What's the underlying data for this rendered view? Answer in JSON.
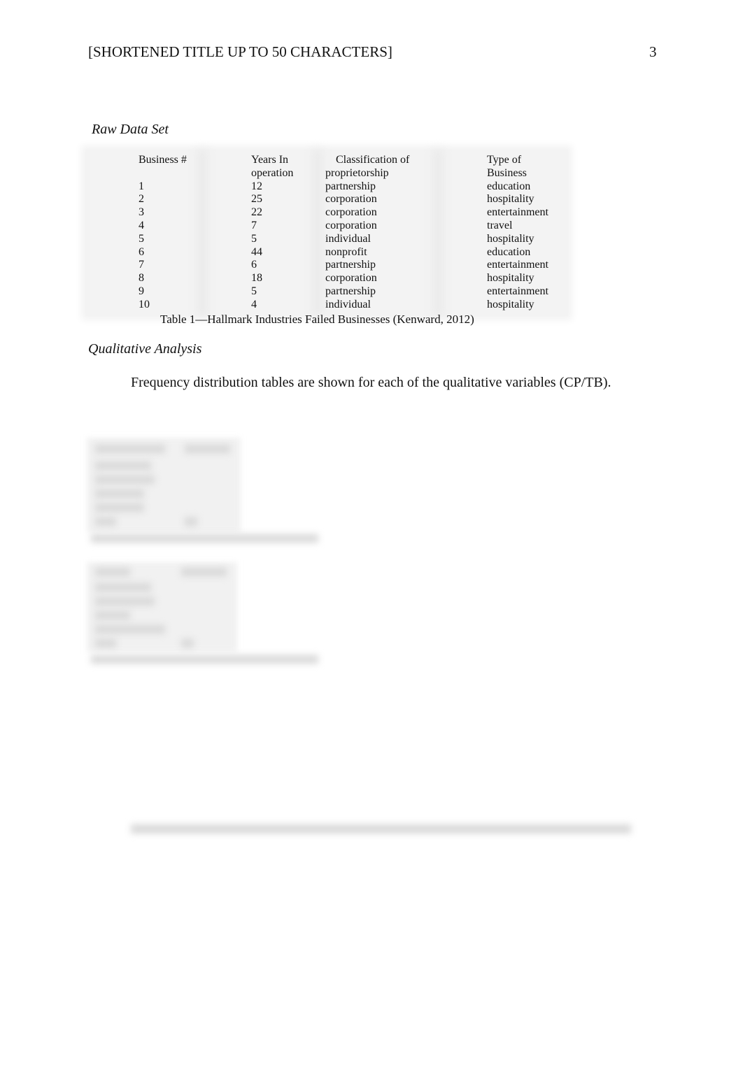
{
  "header": {
    "title": "[SHORTENED TITLE UP TO 50 CHARACTERS]",
    "page_number": "3"
  },
  "raw_data_heading": "Raw Data Set",
  "table1": {
    "headers": [
      [
        "Business #",
        ""
      ],
      [
        "Years In",
        "operation"
      ],
      [
        "Classification of",
        "proprietorship"
      ],
      [
        "Type of",
        "Business"
      ]
    ],
    "rows": [
      [
        "1",
        "12",
        "partnership",
        "education"
      ],
      [
        "2",
        "25",
        "corporation",
        "hospitality"
      ],
      [
        "3",
        "22",
        "corporation",
        "entertainment"
      ],
      [
        "4",
        "7",
        "corporation",
        "travel"
      ],
      [
        "5",
        "5",
        "individual",
        "hospitality"
      ],
      [
        "6",
        "44",
        "nonprofit",
        "education"
      ],
      [
        "7",
        "6",
        "partnership",
        "entertainment"
      ],
      [
        "8",
        "18",
        "corporation",
        "hospitality"
      ],
      [
        "9",
        "5",
        "partnership",
        "entertainment"
      ],
      [
        "10",
        "4",
        "individual",
        "hospitality"
      ]
    ],
    "caption": "Table 1—Hallmark Industries Failed Businesses (Kenward, 2012)"
  },
  "qualitative_heading": "Qualitative Analysis",
  "paragraph": "Frequency distribution tables are shown for each of the qualitative variables (CP/TB)."
}
